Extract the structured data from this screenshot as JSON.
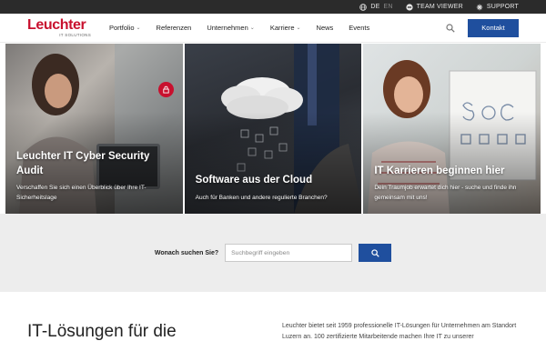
{
  "topbar": {
    "lang_active": "DE",
    "lang_inactive": "EN",
    "teamviewer": "TEAM VIEWER",
    "support": "SUPPORT"
  },
  "header": {
    "logo_word": "Leuchter",
    "logo_sub": "IT SOLUTIONS",
    "nav": [
      {
        "label": "Portfolio",
        "has_dropdown": true
      },
      {
        "label": "Referenzen",
        "has_dropdown": false
      },
      {
        "label": "Unternehmen",
        "has_dropdown": true
      },
      {
        "label": "Karriere",
        "has_dropdown": true
      },
      {
        "label": "News",
        "has_dropdown": false
      },
      {
        "label": "Events",
        "has_dropdown": false
      }
    ],
    "cta": "Kontakt"
  },
  "tiles": [
    {
      "title": "Leuchter IT Cyber Security Audit",
      "desc": "Verschaffen Sie sich einen Überblick über Ihre IT-Sicherheitslage"
    },
    {
      "title": "Software aus der Cloud",
      "desc": "Auch für Banken und andere regulierte Branchen?"
    },
    {
      "title": "IT Karrieren beginnen hier",
      "desc": "Dein Traumjob erwartet dich hier - suche und finde ihn gemeinsam mit uns!"
    }
  ],
  "search": {
    "label": "Wonach suchen Sie?",
    "placeholder": "Suchbegriff eingeben"
  },
  "intro": {
    "heading": "IT-Lösungen für die",
    "text": "Leuchter bietet seit 1959 professionelle IT-Lösungen für Unternehmen am Standort Luzern an. 100 zertifizierte Mitarbeitende machen Ihre IT zu unserer"
  },
  "colors": {
    "brand_red": "#c8102e",
    "brand_blue": "#1f4f9e",
    "topbar_bg": "#2b2b2b"
  },
  "icons": [
    "globe-icon",
    "teamviewer-icon",
    "support-icon",
    "search-icon",
    "lock-icon"
  ]
}
